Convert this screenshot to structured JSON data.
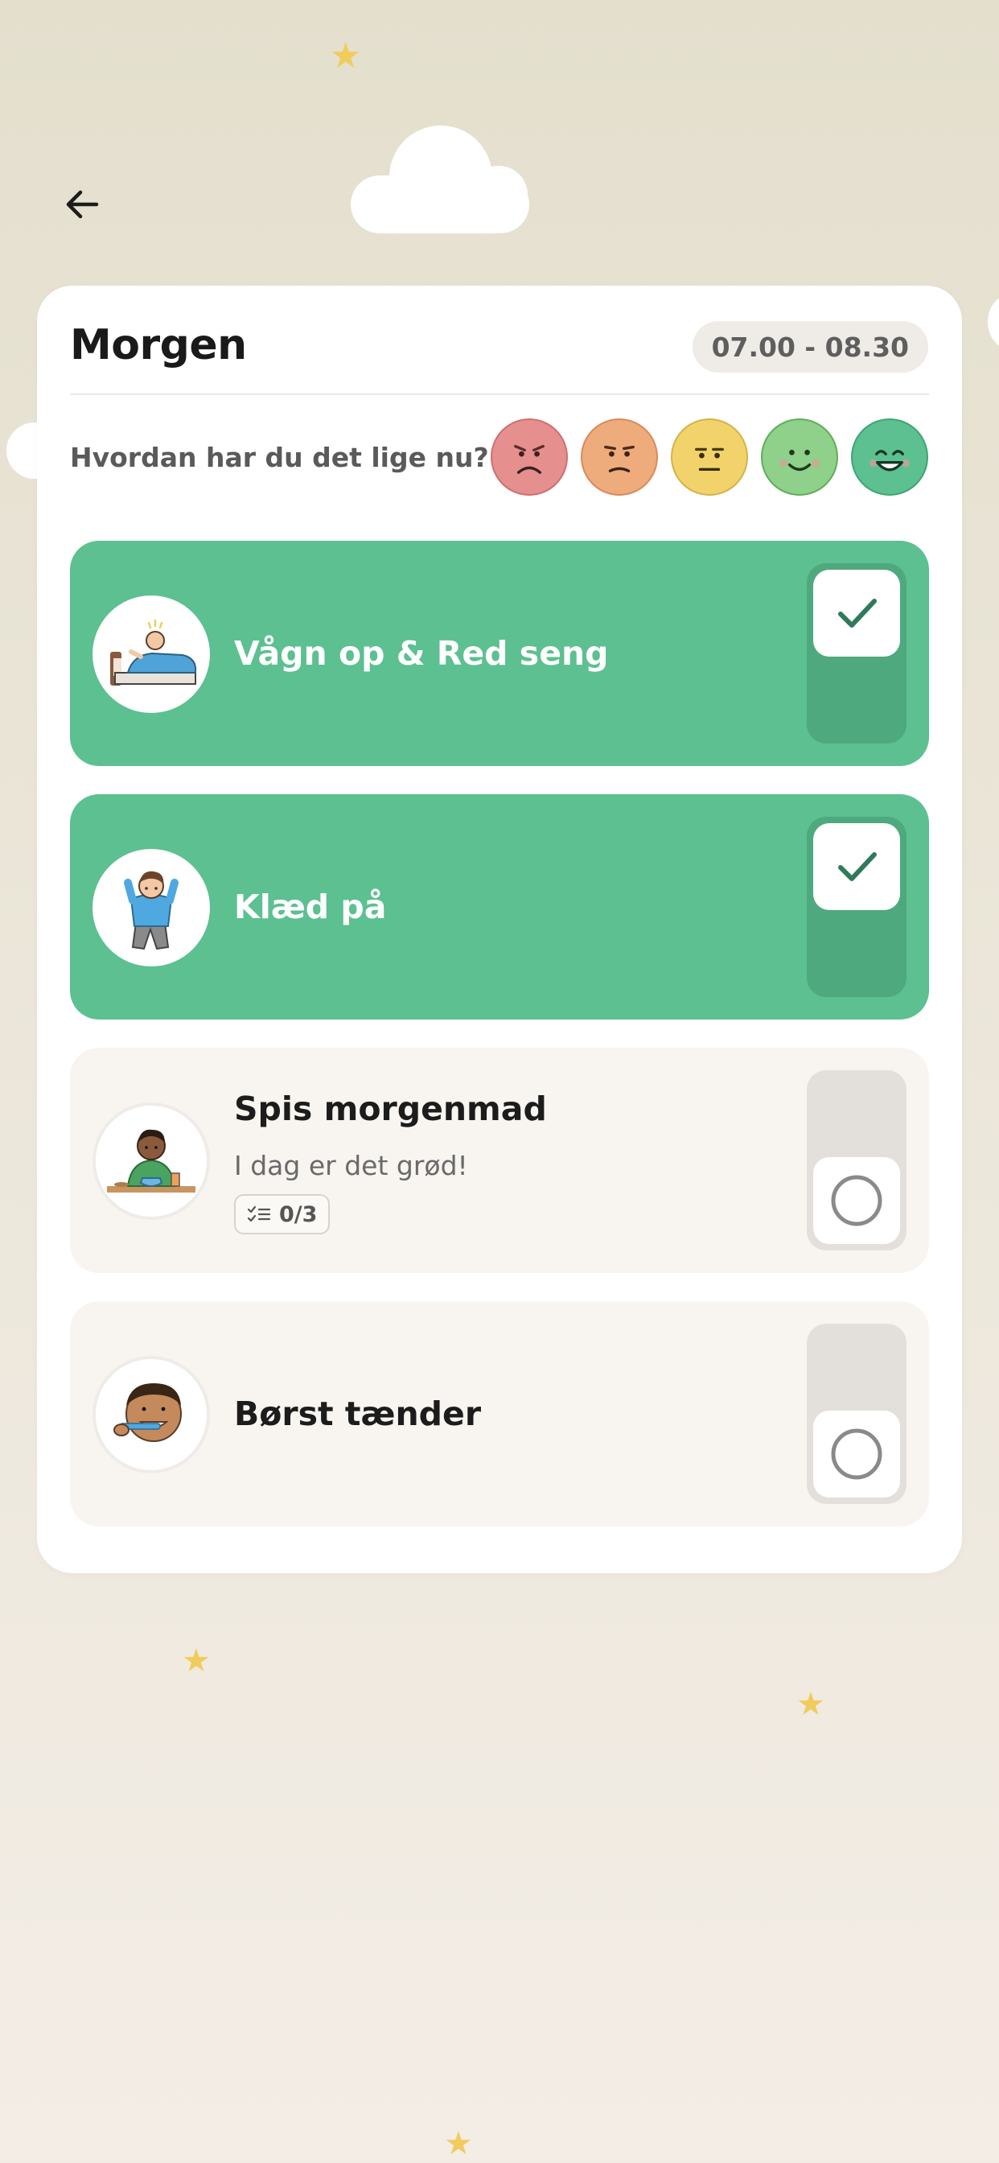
{
  "header": {
    "back_icon": "arrow-left-icon"
  },
  "routine": {
    "title": "Morgen",
    "time_range": "07.00 - 08.30",
    "mood_question": "Hvordan har du det lige nu?",
    "moods": [
      {
        "name": "angry",
        "color": "#e68f8f",
        "border": "#cf6f6f"
      },
      {
        "name": "annoyed",
        "color": "#eeab7c",
        "border": "#d88b5a"
      },
      {
        "name": "neutral",
        "color": "#f2d36b",
        "border": "#d5b347"
      },
      {
        "name": "happy",
        "color": "#8fd08a",
        "border": "#5fae5a"
      },
      {
        "name": "very-happy",
        "color": "#5cc091",
        "border": "#3ea574"
      }
    ],
    "tasks": [
      {
        "label": "Vågn op & Red seng",
        "done": true,
        "icon": "wake-up-make-bed-illustration"
      },
      {
        "label": "Klæd på",
        "done": true,
        "icon": "get-dressed-illustration"
      },
      {
        "label": "Spis morgenmad",
        "subtitle": "I dag er det grød!",
        "checklist": "0/3",
        "done": false,
        "icon": "eat-breakfast-illustration"
      },
      {
        "label": "Børst tænder",
        "done": false,
        "icon": "brush-teeth-illustration"
      }
    ]
  },
  "colors": {
    "done_green": "#5cc091",
    "check_green": "#2f7a5a",
    "star_yellow": "#f0cc5c"
  }
}
